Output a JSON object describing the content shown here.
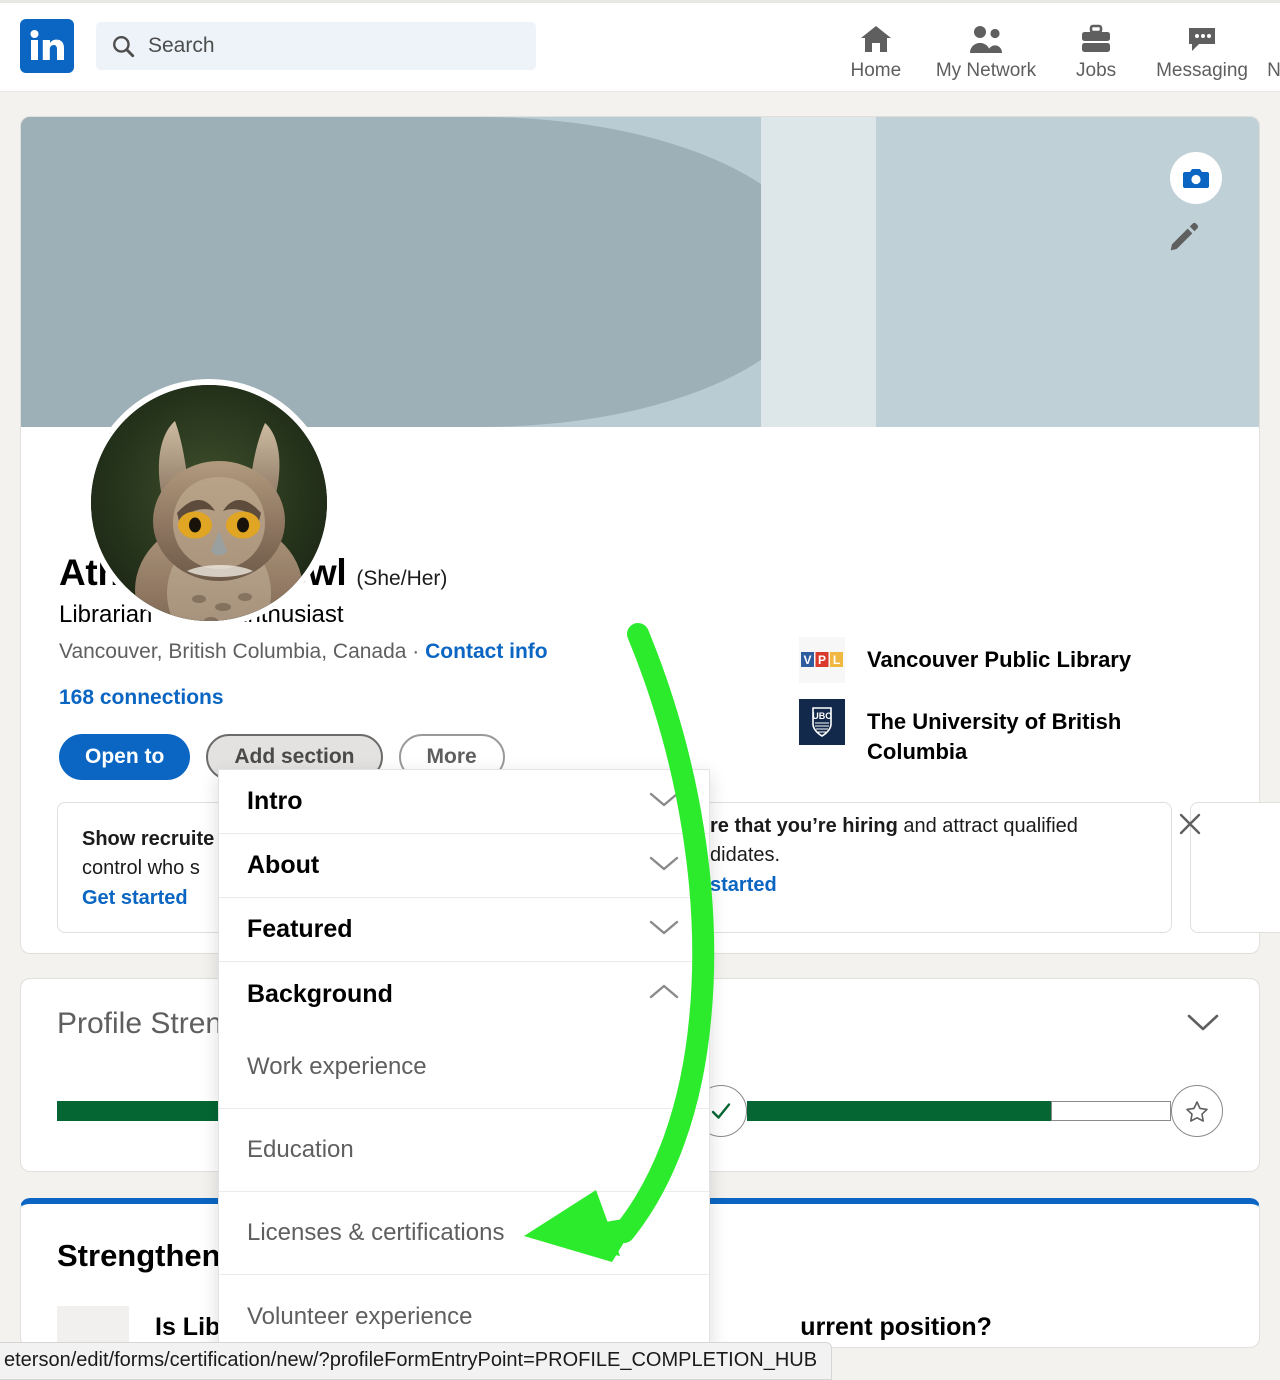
{
  "nav": {
    "logo_icon": "linkedin-logo-icon",
    "search": {
      "placeholder": "Search",
      "value": "",
      "icon": "search-icon"
    },
    "items": [
      {
        "label": "Home",
        "icon": "home-icon"
      },
      {
        "label": "My Network",
        "icon": "people-icon"
      },
      {
        "label": "Jobs",
        "icon": "briefcase-icon"
      },
      {
        "label": "Messaging",
        "icon": "message-bubble-icon"
      },
      {
        "label": "N",
        "icon": "notifications-icon"
      }
    ]
  },
  "profile": {
    "banner_camera_icon": "camera-icon",
    "edit_icon": "pencil-icon",
    "avatar_icon": "owl-avatar",
    "name": "Athena Nightowl",
    "pronouns": "(She/Her)",
    "headline": "Librarian • Barn Enthusiast",
    "location": "Vancouver, British Columbia, Canada · ",
    "contact_info": "Contact info",
    "connections": "168 connections",
    "buttons": {
      "open_to": "Open to",
      "add_section": "Add section",
      "more": "More"
    },
    "organizations": [
      {
        "name": "Vancouver Public Library",
        "logo_icon": "vpl-logo-icon"
      },
      {
        "name": "The University of British Columbia",
        "logo_icon": "ubc-logo-icon"
      }
    ]
  },
  "promos": [
    {
      "text_before": "Show recruite",
      "text_line2": "control who s",
      "link": "Get started",
      "close_icon": "close-icon"
    },
    {
      "text_bold": "re that you’re hiring",
      "text_rest": " and attract qualified",
      "text_line2": "didates.",
      "link": "started",
      "next_icon": "chevron-right-icon"
    }
  ],
  "profile_strength": {
    "title": "Profile Strength",
    "collapse_icon": "chevron-down-icon",
    "check_icon": "check-icon",
    "star_icon": "star-icon"
  },
  "dropdown": {
    "sections": [
      {
        "label": "Intro",
        "chevron": "chevron-down-icon",
        "expanded": false
      },
      {
        "label": "About",
        "chevron": "chevron-down-icon",
        "expanded": false
      },
      {
        "label": "Featured",
        "chevron": "chevron-down-icon",
        "expanded": false
      },
      {
        "label": "Background",
        "chevron": "chevron-up-icon",
        "expanded": true
      }
    ],
    "background_items": [
      {
        "label": "Work experience"
      },
      {
        "label": "Education"
      },
      {
        "label": "Licenses & certifications"
      },
      {
        "label": "Volunteer experience"
      }
    ]
  },
  "bottom_card": {
    "title": "Strengthen",
    "question_left": "Is Lib",
    "question_right": "urrent position?"
  },
  "status_bar": {
    "url": "eterson/edit/forms/certification/new/?profileFormEntryPoint=PROFILE_COMPLETION_HUB"
  },
  "annotation": {
    "arrow_color": "#2ceb2c",
    "points_to": "Licenses & certifications"
  },
  "colors": {
    "brand_blue": "#0a66c2",
    "bg": "#f4f2ee",
    "green_progress": "#056633"
  }
}
